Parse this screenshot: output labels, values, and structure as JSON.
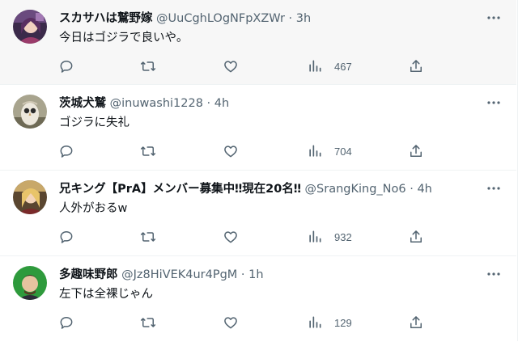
{
  "tweets": [
    {
      "name": "スカサハは鷲野嫁",
      "handle": "@UuCghLOgNFpXZWr",
      "dot": "·",
      "time": "3h",
      "text": "今日はゴジラで良いや。",
      "views": "467",
      "avatar": "anime-character-avatar"
    },
    {
      "name": "茨城犬鷲",
      "handle": "@inuwashi1228",
      "dot": "·",
      "time": "4h",
      "text": "ゴジラに失礼",
      "views": "704",
      "avatar": "owl-avatar"
    },
    {
      "name": "兄キング【PrA】メンバー募集中‼現在20名‼",
      "handle": "@SrangKing_No6",
      "dot": "·",
      "time": "4h",
      "text": "人外がおるw",
      "views": "932",
      "avatar": "anime-character-avatar"
    },
    {
      "name": "多趣味野郎",
      "handle": "@Jz8HiVEK4ur4PgM",
      "dot": "·",
      "time": "1h",
      "text": "左下は全裸じゃん",
      "views": "129",
      "avatar": "anime-character-avatar"
    }
  ],
  "colors": {
    "icon_gray": "#536471",
    "text_primary": "#0f1419",
    "divider": "#eff3f4",
    "hover_bg": "#f7f7f7"
  }
}
